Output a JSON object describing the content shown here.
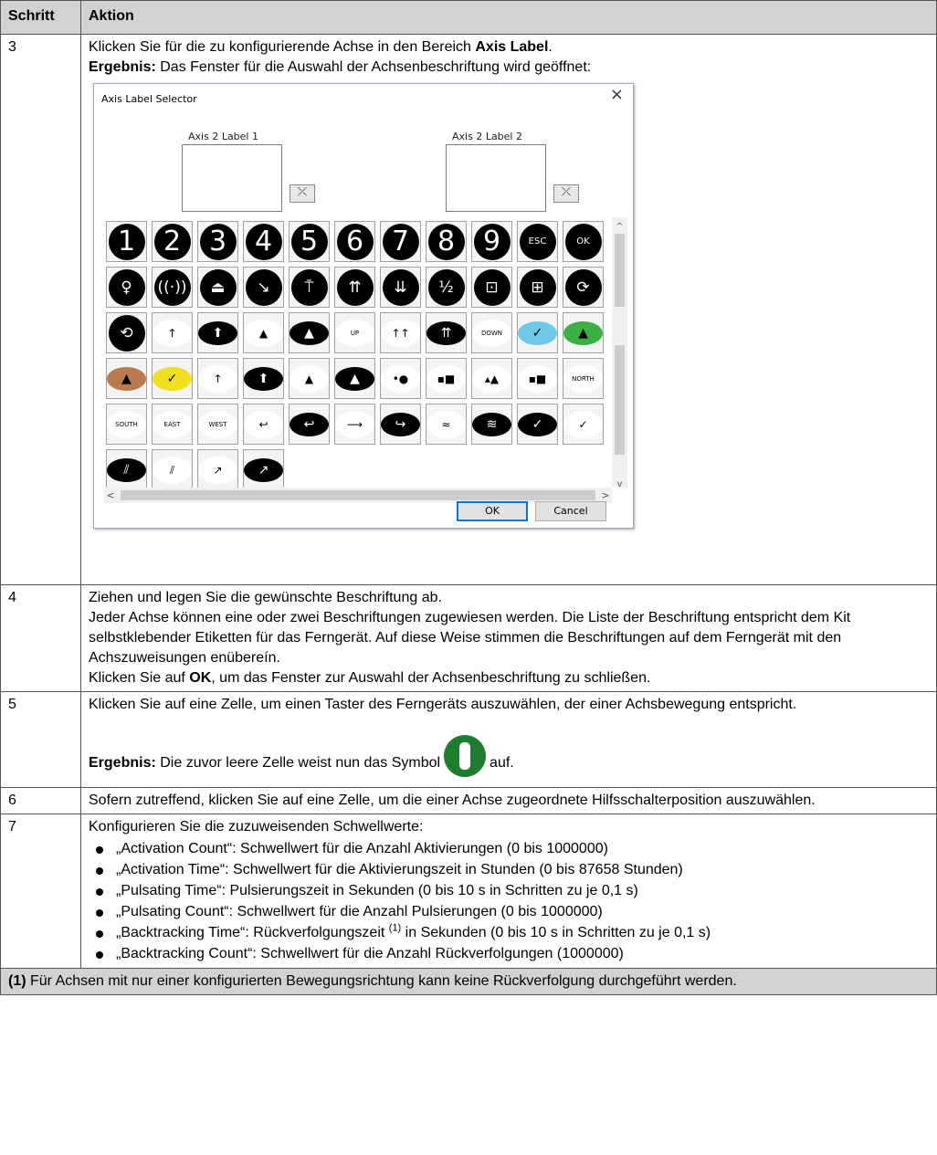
{
  "headers": {
    "step": "Schritt",
    "action": "Aktion"
  },
  "row3": {
    "step": "3",
    "line1_pre": "Klicken Sie für die zu konfigurierende Achse in den Bereich ",
    "line1_bold": "Axis Label",
    "line1_post": ".",
    "line2_bold": "Ergebnis:",
    "line2_post": " Das Fenster für die Auswahl der Achsenbeschriftung wird geöffnet:"
  },
  "dialog": {
    "title": "Axis Label Selector",
    "close_glyph": "×",
    "label1_caption": "Axis 2 Label 1",
    "label2_caption": "Axis 2 Label 2",
    "clear_glyph": "⤫",
    "ok_label": "OK",
    "cancel_label": "Cancel",
    "scroll_up": "^",
    "scroll_down": "v",
    "scroll_left": "<",
    "scroll_right": ">",
    "palette": [
      {
        "kind": "circ num",
        "text": "1",
        "icon": "number-1-icon"
      },
      {
        "kind": "circ num",
        "text": "2",
        "icon": "number-2-icon"
      },
      {
        "kind": "circ num",
        "text": "3",
        "icon": "number-3-icon"
      },
      {
        "kind": "circ num",
        "text": "4",
        "icon": "number-4-icon"
      },
      {
        "kind": "circ num",
        "text": "5",
        "icon": "number-5-icon"
      },
      {
        "kind": "circ num",
        "text": "6",
        "icon": "number-6-icon"
      },
      {
        "kind": "circ num",
        "text": "7",
        "icon": "number-7-icon"
      },
      {
        "kind": "circ num",
        "text": "8",
        "icon": "number-8-icon"
      },
      {
        "kind": "circ num",
        "text": "9",
        "icon": "number-9-icon"
      },
      {
        "kind": "circ txt",
        "text": "ESC",
        "icon": "esc-icon"
      },
      {
        "kind": "circ txt",
        "text": "OK",
        "icon": "ok-icon"
      },
      {
        "kind": "circ sym",
        "text": "♀",
        "icon": "lamp-icon"
      },
      {
        "kind": "circ sym",
        "text": "((·))",
        "icon": "horn-icon"
      },
      {
        "kind": "circ sym",
        "text": "⏏",
        "icon": "lift-icon"
      },
      {
        "kind": "circ sym",
        "text": "↘",
        "icon": "tilt-icon"
      },
      {
        "kind": "circ sym",
        "text": "⍑",
        "icon": "hoist-icon"
      },
      {
        "kind": "circ sym",
        "text": "⇈",
        "icon": "clamp-open-icon"
      },
      {
        "kind": "circ sym",
        "text": "⇊",
        "icon": "clamp-close-icon"
      },
      {
        "kind": "circ sym",
        "text": "½",
        "icon": "speed-select-icon"
      },
      {
        "kind": "circ sym",
        "text": "⊡",
        "icon": "gripper-close-icon"
      },
      {
        "kind": "circ sym",
        "text": "⊞",
        "icon": "gripper-open-icon"
      },
      {
        "kind": "circ sym",
        "text": "⟳",
        "icon": "rotate-icon"
      },
      {
        "kind": "circ sym",
        "text": "⟲",
        "icon": "rotate-reverse-icon"
      },
      {
        "kind": "oval white",
        "text": "↑",
        "icon": "arrow-up-icon"
      },
      {
        "kind": "oval black",
        "text": "⬆",
        "icon": "arrow-up-fast-icon"
      },
      {
        "kind": "oval white",
        "text": "▲",
        "icon": "tree-up-icon"
      },
      {
        "kind": "oval black",
        "text": "▲",
        "icon": "tree-up-fast-icon"
      },
      {
        "kind": "oval white word",
        "text": "UP",
        "icon": "up-word-icon"
      },
      {
        "kind": "oval white",
        "text": "↑↑",
        "icon": "double-arrow-up-icon"
      },
      {
        "kind": "oval black",
        "text": "⇈",
        "icon": "double-arrow-up-fast-icon"
      },
      {
        "kind": "oval white word",
        "text": "DOWN",
        "icon": "down-word-icon"
      },
      {
        "kind": "oval blue",
        "text": "✓",
        "icon": "plane-blue-icon"
      },
      {
        "kind": "oval green",
        "text": "▲",
        "icon": "tree-green-icon"
      },
      {
        "kind": "oval brown",
        "text": "▲",
        "icon": "tree-brown-icon"
      },
      {
        "kind": "oval yellow",
        "text": "✓",
        "icon": "plane-yellow-icon"
      },
      {
        "kind": "oval white",
        "text": "↑",
        "icon": "arrow-up-small-icon"
      },
      {
        "kind": "oval black",
        "text": "⬆",
        "icon": "arrow-up-bold-icon"
      },
      {
        "kind": "oval white",
        "text": "▲",
        "icon": "tree-small-icon"
      },
      {
        "kind": "oval black",
        "text": "▲",
        "icon": "tree-bold-icon"
      },
      {
        "kind": "oval white",
        "text": "•●",
        "icon": "dots-icon"
      },
      {
        "kind": "oval white",
        "text": "▪■",
        "icon": "squares-icon"
      },
      {
        "kind": "oval white",
        "text": "▴▲",
        "icon": "triangles-icon"
      },
      {
        "kind": "oval white",
        "text": "▪■",
        "icon": "squares-bold-icon"
      },
      {
        "kind": "oval white word",
        "text": "NORTH",
        "icon": "north-word-icon"
      },
      {
        "kind": "oval white word",
        "text": "SOUTH",
        "icon": "south-word-icon"
      },
      {
        "kind": "oval white word",
        "text": "EAST",
        "icon": "east-word-icon"
      },
      {
        "kind": "oval white word",
        "text": "WEST",
        "icon": "west-word-icon"
      },
      {
        "kind": "oval white",
        "text": "↩",
        "icon": "curve-left-icon"
      },
      {
        "kind": "oval black",
        "text": "↩",
        "icon": "curve-left-bold-icon"
      },
      {
        "kind": "oval white",
        "text": "⟶",
        "icon": "curve-right-icon"
      },
      {
        "kind": "oval black",
        "text": "↪",
        "icon": "curve-right-bold-icon"
      },
      {
        "kind": "oval white",
        "text": "≈",
        "icon": "wave-icon"
      },
      {
        "kind": "oval black",
        "text": "≋",
        "icon": "wave-bold-icon"
      },
      {
        "kind": "oval black",
        "text": "✓",
        "icon": "plane-bold-icon"
      },
      {
        "kind": "oval white",
        "text": "✓",
        "icon": "plane-small-icon"
      },
      {
        "kind": "oval black",
        "text": "⫽",
        "icon": "diagonal-bold-icon"
      },
      {
        "kind": "oval white",
        "text": "⫽",
        "icon": "diagonal-icon"
      },
      {
        "kind": "oval white",
        "text": "↗",
        "icon": "arrow-diagonal-icon"
      },
      {
        "kind": "oval black",
        "text": "↗",
        "icon": "arrow-diagonal-bold-icon"
      }
    ]
  },
  "row4": {
    "step": "4",
    "line1": "Ziehen und legen Sie die gewünschte Beschriftung ab.",
    "line2": "Jeder Achse können eine oder zwei Beschriftungen zugewiesen werden. Die Liste der Beschriftung entspricht dem Kit selbstklebender Etiketten für das Ferngerät. Auf diese Weise stimmen die Beschriftungen auf dem Ferngerät mit den Achszuweisungen enübereín.",
    "line3_pre": "Klicken Sie auf ",
    "line3_bold": "OK",
    "line3_post": ", um das Fenster zur Auswahl der Achsenbeschriftung zu schließen."
  },
  "row5": {
    "step": "5",
    "line1": "Klicken Sie auf eine Zelle, um einen Taster des Ferngeräts auszuwählen, der einer Achsbewegung entspricht.",
    "line2_bold": "Ergebnis:",
    "line2_pre": " Die zuvor leere Zelle weist nun das Symbol",
    "line2_post": "auf."
  },
  "row6": {
    "step": "6",
    "line1": "Sofern zutreffend, klicken Sie auf eine Zelle, um die einer Achse zugeordnete Hilfsschalterposition auszuwählen."
  },
  "row7": {
    "step": "7",
    "intro": "Konfigurieren Sie die zuzuweisenden Schwellwerte:",
    "items": [
      "„Activation Count“: Schwellwert für die Anzahl Aktivierungen (0 bis 1000000)",
      "„Activation Time“: Schwellwert für die Aktivierungszeit in Stunden (0 bis 87658 Stunden)",
      "„Pulsating Time“: Pulsierungszeit in Sekunden (0 bis 10 s in Schritten zu je 0,1 s)",
      "„Pulsating Count“: Schwellwert für die Anzahl Pulsierungen (0 bis 1000000)"
    ],
    "item5_pre": "„Backtracking Time“: Rückverfolgungszeit ",
    "item5_sup": "(1)",
    "item5_post": " in Sekunden (0 bis 10 s in Schritten zu je 0,1 s)",
    "item6": "„Backtracking Count“: Schwellwert für die Anzahl Rückverfolgungen (1000000)"
  },
  "footnote": {
    "marker": "(1)",
    "text": " Für Achsen mit nur einer konfigurierten Bewegungsrichtung kann keine Rückverfolgung durchgeführt werden."
  }
}
